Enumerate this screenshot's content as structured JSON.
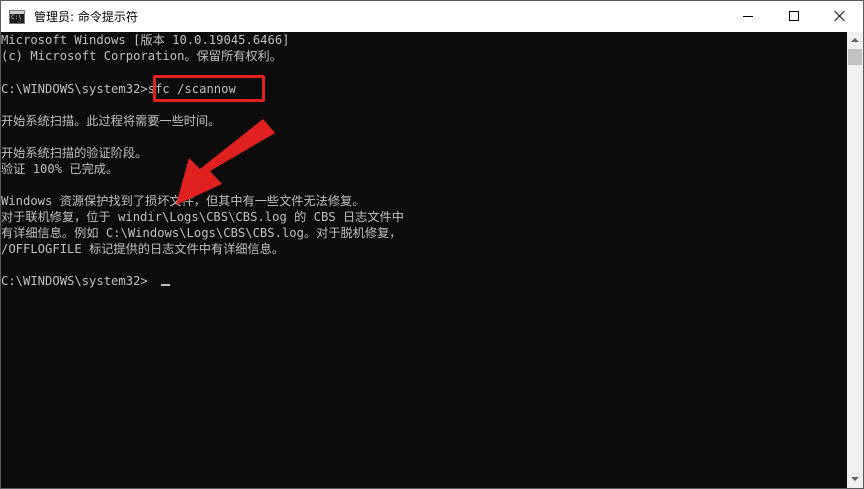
{
  "window": {
    "title": "管理员: 命令提示符",
    "app_icon": "cmd-icon",
    "controls": {
      "minimize_icon": "minimize-icon",
      "maximize_icon": "maximize-icon",
      "close_icon": "close-icon"
    }
  },
  "console": {
    "lines": [
      "Microsoft Windows [版本 10.0.19045.6466]",
      "(c) Microsoft Corporation。保留所有权利。",
      "",
      "C:\\WINDOWS\\system32>sfc /scannow",
      "",
      "开始系统扫描。此过程将需要一些时间。",
      "",
      "开始系统扫描的验证阶段。",
      "验证 100% 已完成。",
      "",
      "Windows 资源保护找到了损坏文件，但其中有一些文件无法修复。",
      "对于联机修复，位于 windir\\Logs\\CBS\\CBS.log 的 CBS 日志文件中",
      "有详细信息。例如 C:\\Windows\\Logs\\CBS\\CBS.log。对于脱机修复，",
      "/OFFLOGFILE 标记提供的日志文件中有详细信息。",
      "",
      "C:\\WINDOWS\\system32>"
    ]
  },
  "annotation": {
    "highlight_color": "#e12020",
    "arrow_color": "#e12020"
  },
  "colors": {
    "console_bg": "#0c0c0c",
    "console_text": "#c0c0c0",
    "titlebar_bg": "#ffffff"
  }
}
